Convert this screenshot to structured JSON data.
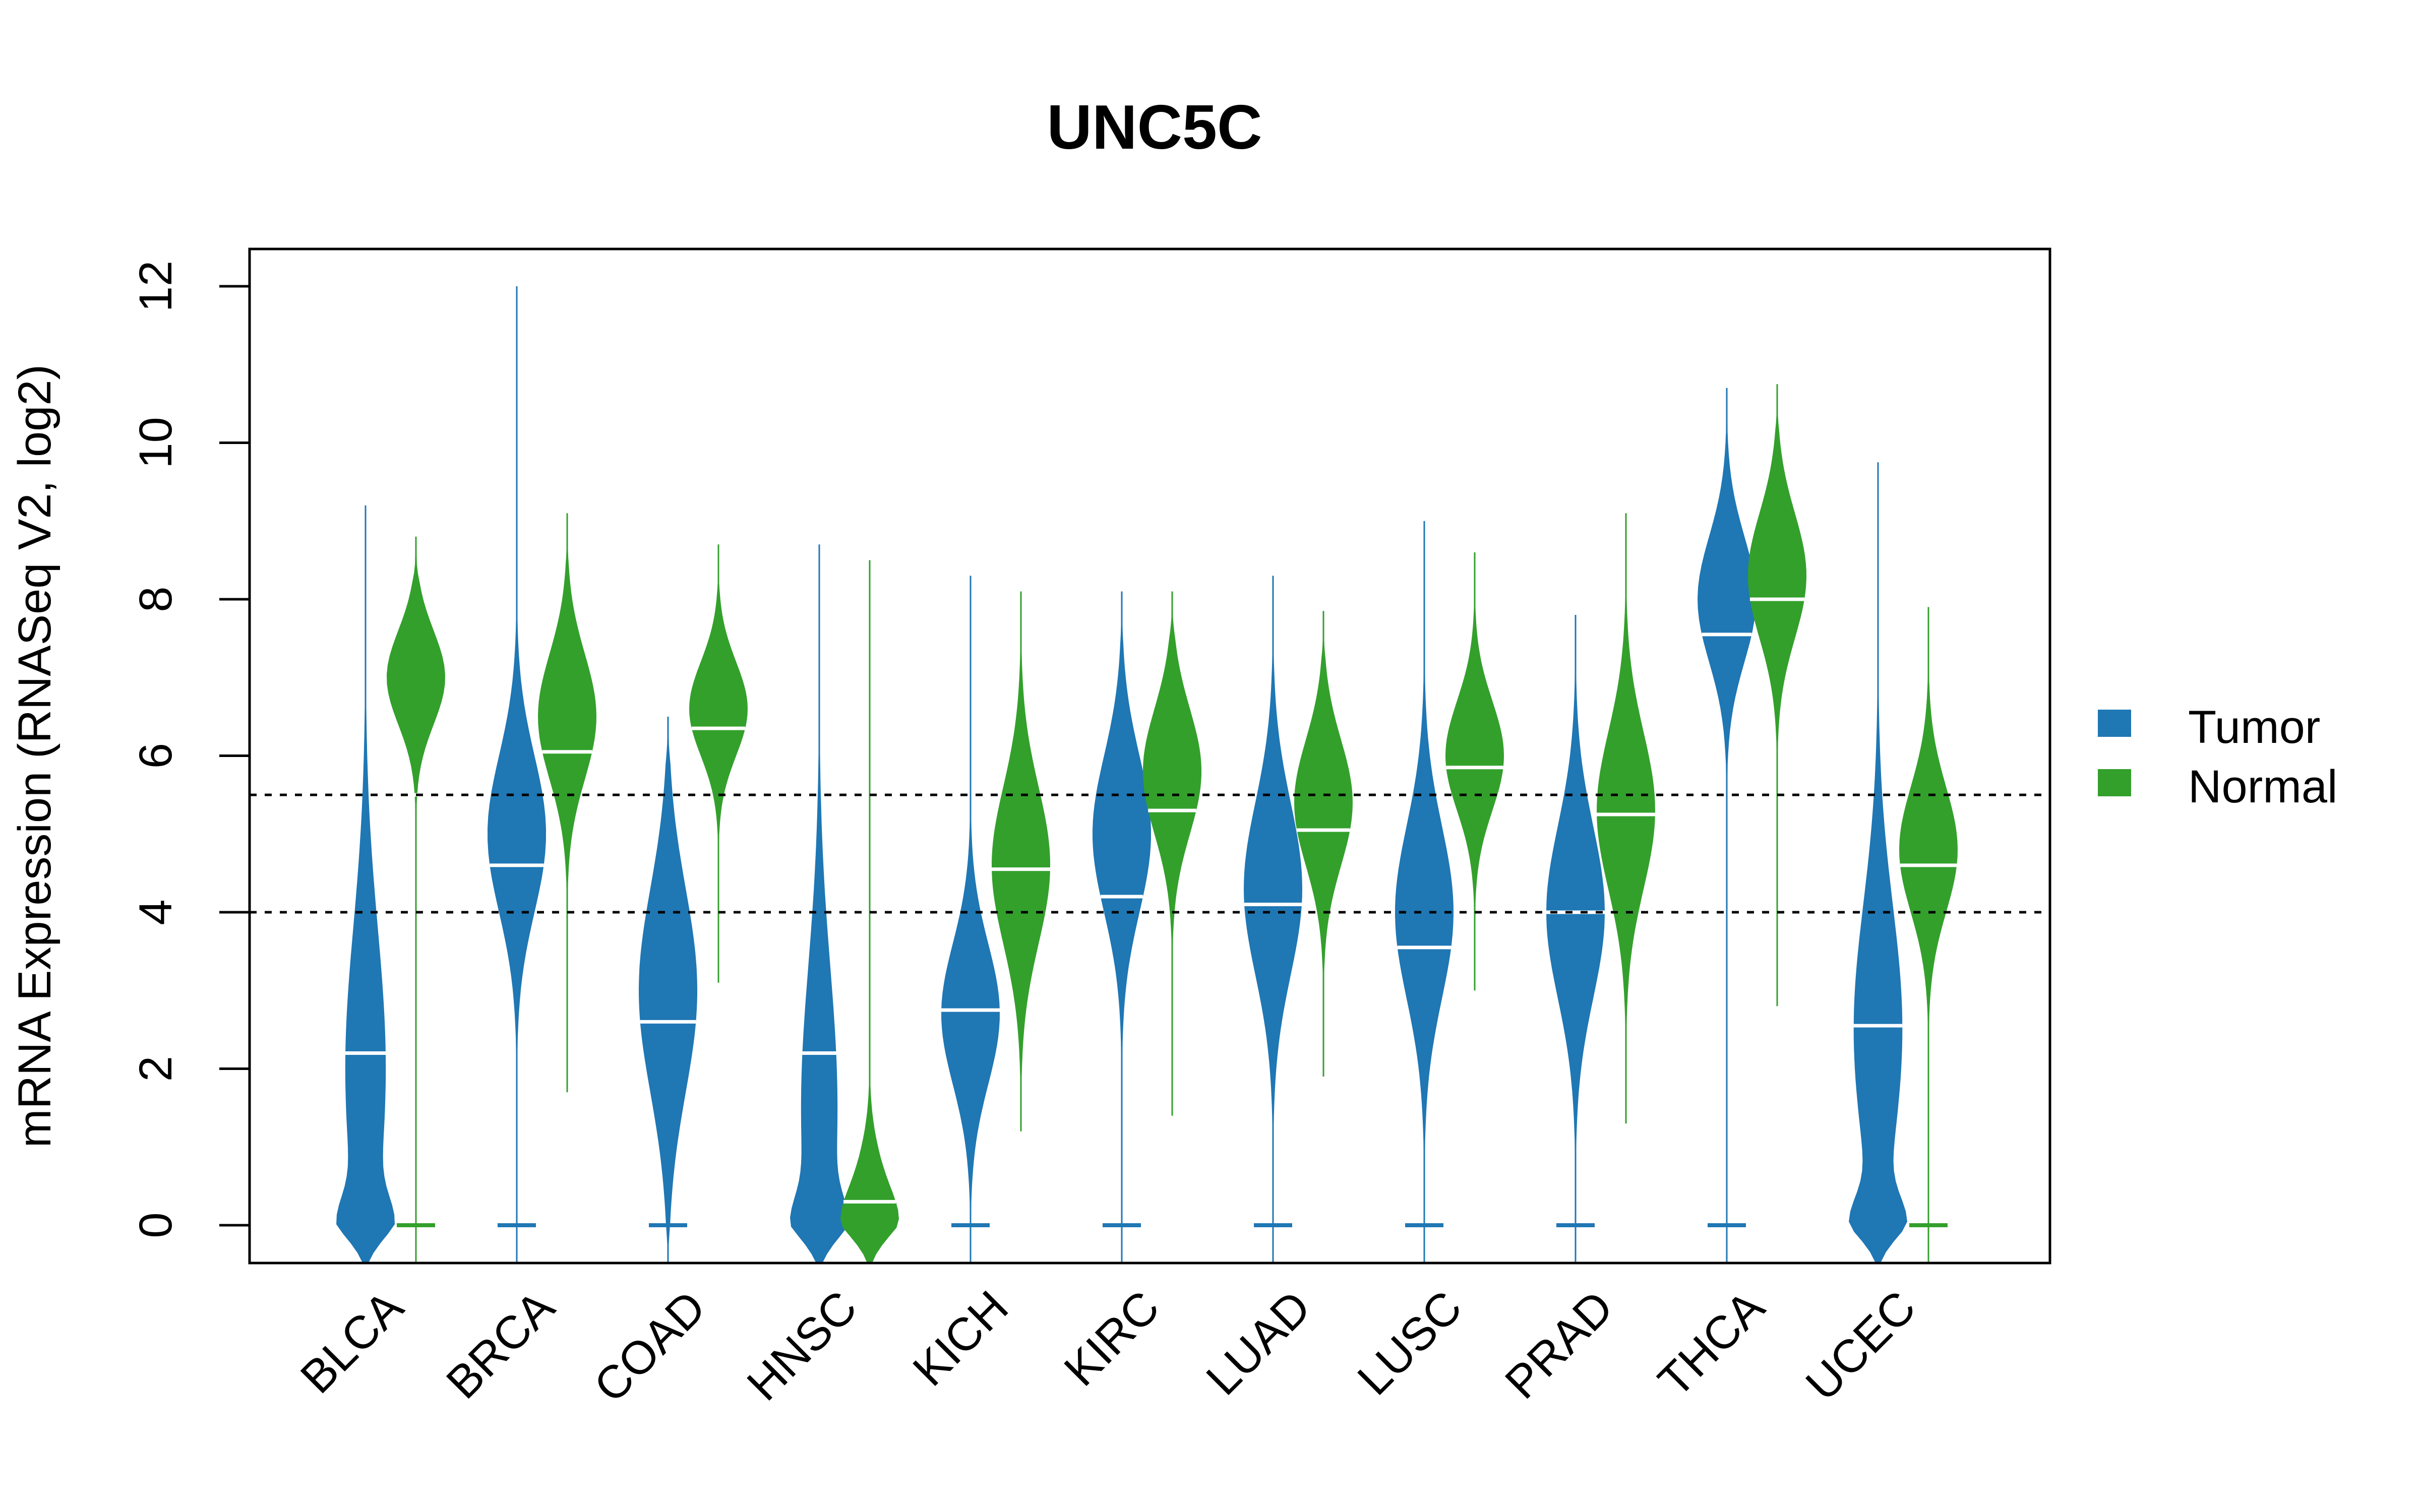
{
  "chart_data": {
    "type": "violin",
    "title": "UNC5C",
    "xlabel": "",
    "ylabel": "mRNA Expression (RNASeq V2, log2)",
    "ylim": [
      -0.5,
      12.5
    ],
    "yticks": [
      0,
      2,
      4,
      6,
      8,
      10,
      12
    ],
    "ytick_labels": [
      "0",
      "2",
      "4",
      "6",
      "8",
      "10",
      "12"
    ],
    "grid": false,
    "reference_lines": [
      {
        "y": 5.5,
        "style": "dotted"
      },
      {
        "y": 4.0,
        "style": "dotted"
      }
    ],
    "categories": [
      "BLCA",
      "BRCA",
      "COAD",
      "HNSC",
      "KICH",
      "KIRC",
      "LUAD",
      "LUSC",
      "PRAD",
      "THCA",
      "UCEC"
    ],
    "legend": {
      "placement": "right",
      "entries": [
        {
          "label": "Tumor",
          "color": "#1F77B4"
        },
        {
          "label": "Normal",
          "color": "#33A02C"
        }
      ]
    },
    "series": [
      {
        "name": "Tumor",
        "color": "#1F77B4",
        "groups": [
          {
            "category": "BLCA",
            "min": 0,
            "max": 9.2,
            "median": 2.2,
            "peak": 2.0,
            "peak_spread": 1.8,
            "zero_heavy": true
          },
          {
            "category": "BRCA",
            "min": 0,
            "max": 12.0,
            "median": 4.6,
            "peak": 5.0,
            "peak_spread": 1.0,
            "zero_heavy": false
          },
          {
            "category": "COAD",
            "min": 0,
            "max": 6.5,
            "median": 2.6,
            "peak": 3.0,
            "peak_spread": 1.3,
            "zero_heavy": false
          },
          {
            "category": "HNSC",
            "min": 0,
            "max": 8.7,
            "median": 2.2,
            "peak": 1.5,
            "peak_spread": 1.8,
            "zero_heavy": true
          },
          {
            "category": "KICH",
            "min": 0,
            "max": 8.3,
            "median": 2.75,
            "peak": 2.7,
            "peak_spread": 0.9,
            "zero_heavy": false
          },
          {
            "category": "KIRC",
            "min": 0,
            "max": 8.1,
            "median": 4.2,
            "peak": 5.0,
            "peak_spread": 1.0,
            "zero_heavy": false
          },
          {
            "category": "LUAD",
            "min": 0,
            "max": 8.3,
            "median": 4.1,
            "peak": 4.3,
            "peak_spread": 1.1,
            "zero_heavy": false
          },
          {
            "category": "LUSC",
            "min": 0,
            "max": 9.0,
            "median": 3.55,
            "peak": 4.0,
            "peak_spread": 1.1,
            "zero_heavy": false
          },
          {
            "category": "PRAD",
            "min": 0,
            "max": 7.8,
            "median": 4.0,
            "peak": 4.0,
            "peak_spread": 1.1,
            "zero_heavy": false
          },
          {
            "category": "THCA",
            "min": 0,
            "max": 10.7,
            "median": 7.55,
            "peak": 8.0,
            "peak_spread": 0.8,
            "zero_heavy": false
          },
          {
            "category": "UCEC",
            "min": 0,
            "max": 9.75,
            "median": 2.55,
            "peak": 2.5,
            "peak_spread": 1.6,
            "zero_heavy": true
          }
        ]
      },
      {
        "name": "Normal",
        "color": "#33A02C",
        "groups": [
          {
            "category": "BLCA",
            "min": 0,
            "max": 8.8,
            "median": 5.5,
            "peak": 7.0,
            "peak_spread": 0.6,
            "zero_heavy": false
          },
          {
            "category": "BRCA",
            "min": 1.8,
            "max": 9.1,
            "median": 6.05,
            "peak": 6.5,
            "peak_spread": 0.8,
            "zero_heavy": false
          },
          {
            "category": "COAD",
            "min": 3.2,
            "max": 8.7,
            "median": 6.35,
            "peak": 6.6,
            "peak_spread": 0.6,
            "zero_heavy": false
          },
          {
            "category": "HNSC",
            "min": 0,
            "max": 8.5,
            "median": 0.3,
            "peak": 0.3,
            "peak_spread": 0.6,
            "zero_heavy": true
          },
          {
            "category": "KICH",
            "min": 1.3,
            "max": 8.1,
            "median": 4.55,
            "peak": 4.6,
            "peak_spread": 1.0,
            "zero_heavy": false
          },
          {
            "category": "KIRC",
            "min": 1.5,
            "max": 8.1,
            "median": 5.3,
            "peak": 5.8,
            "peak_spread": 0.8,
            "zero_heavy": false
          },
          {
            "category": "LUAD",
            "min": 2.0,
            "max": 7.85,
            "median": 5.05,
            "peak": 5.4,
            "peak_spread": 0.8,
            "zero_heavy": false
          },
          {
            "category": "LUSC",
            "min": 3.1,
            "max": 8.6,
            "median": 5.85,
            "peak": 6.0,
            "peak_spread": 0.7,
            "zero_heavy": false
          },
          {
            "category": "PRAD",
            "min": 1.4,
            "max": 9.1,
            "median": 5.25,
            "peak": 5.3,
            "peak_spread": 1.0,
            "zero_heavy": false
          },
          {
            "category": "THCA",
            "min": 2.9,
            "max": 10.75,
            "median": 8.0,
            "peak": 8.3,
            "peak_spread": 0.8,
            "zero_heavy": false
          },
          {
            "category": "UCEC",
            "min": 0,
            "max": 7.9,
            "median": 4.6,
            "peak": 4.8,
            "peak_spread": 0.8,
            "zero_heavy": false
          }
        ]
      }
    ]
  }
}
